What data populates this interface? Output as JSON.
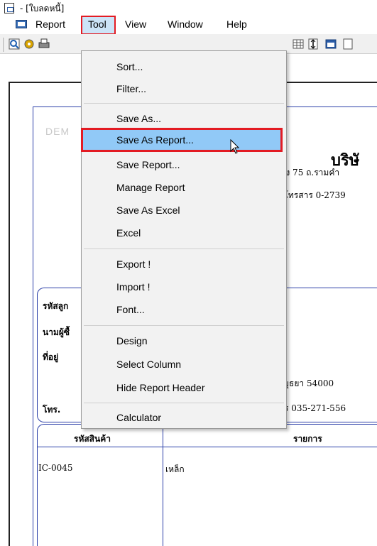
{
  "window": {
    "title": "- [ใบลดหนี้]"
  },
  "menubar": {
    "items": [
      "Report",
      "Tool",
      "View",
      "Window",
      "Help"
    ]
  },
  "tool_menu": {
    "items": [
      "Sort...",
      "Filter...",
      "Save As...",
      "Save As Report...",
      "Save Report...",
      "Manage Report",
      "Save As Excel",
      "Excel",
      "Export !",
      "Import !",
      "Font...",
      "Design",
      "Select Column",
      "Hide Report Header",
      "Calculator"
    ],
    "highlighted": "Save As Report..."
  },
  "report": {
    "watermark": "DEM",
    "company": "บริษั",
    "address": "ำแหง 75 ถ.รามคำ",
    "phone_fax": "0  โทรสาร 0-2739",
    "customer_labels": [
      "รหัสลูก",
      "นามผู้ซื้",
      "ที่อยู่",
      "โทร."
    ],
    "customer_values": {
      "province": "ยุธยา 54000",
      "fax": "ร 035-271-556"
    },
    "table_headers": [
      "รหัสสินค้า",
      "รายการ"
    ],
    "rows": [
      {
        "code": "IC-0045",
        "name": "เหล็ก"
      }
    ]
  },
  "colors": {
    "highlight": "#91c9f7",
    "annotation_red": "#e31b23",
    "frame_blue": "#2b3fa8"
  }
}
